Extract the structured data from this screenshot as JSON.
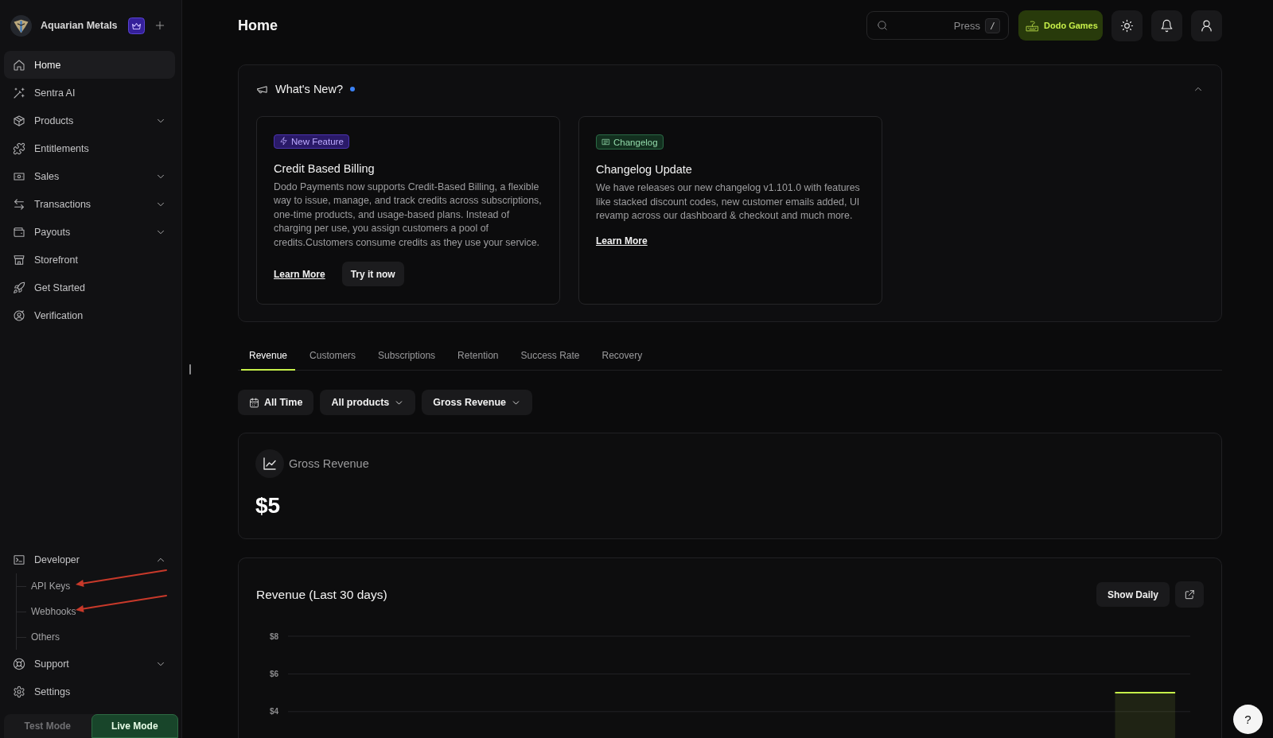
{
  "sidebar": {
    "workspace": {
      "name": "Aquarian Metals"
    },
    "items": [
      {
        "label": "Home",
        "selected": true
      },
      {
        "label": "Sentra AI",
        "selected": false
      },
      {
        "label": "Products",
        "selected": false,
        "expanded": false
      },
      {
        "label": "Entitlements",
        "selected": false
      },
      {
        "label": "Sales",
        "selected": false,
        "expanded": false
      },
      {
        "label": "Transactions",
        "selected": false,
        "expanded": false
      },
      {
        "label": "Payouts",
        "selected": false,
        "expanded": false
      },
      {
        "label": "Storefront",
        "selected": false
      },
      {
        "label": "Get Started",
        "selected": false
      },
      {
        "label": "Verification",
        "selected": false
      }
    ],
    "bottom_items": [
      {
        "label": "Developer",
        "selected": false,
        "expanded": true,
        "children": [
          {
            "label": "API Keys",
            "selected": false,
            "pointed_by_arrow": true
          },
          {
            "label": "Webhooks",
            "selected": false,
            "pointed_by_arrow": true
          },
          {
            "label": "Others",
            "selected": false,
            "pointed_by_arrow": false
          }
        ]
      },
      {
        "label": "Support",
        "selected": false,
        "expanded": false
      },
      {
        "label": "Settings",
        "selected": false
      }
    ],
    "mode_toggle": [
      {
        "label": "Test Mode",
        "selected": false
      },
      {
        "label": "Live Mode",
        "selected": true
      }
    ]
  },
  "header": {
    "title": "Home",
    "search": {
      "hint": "Press",
      "shortcut": "/"
    },
    "account_button": "Dodo Games"
  },
  "whats_new": {
    "title": "What's New?",
    "unread": true,
    "expanded": true,
    "cards": [
      {
        "badge": {
          "kind": "feature",
          "label": "New Feature"
        },
        "title": "Credit Based Billing",
        "text": "Dodo Payments now supports Credit-Based Billing, a flexible way to issue, manage, and track credits across subscriptions, one-time products, and usage-based plans. Instead of charging per use, you assign customers a pool of credits.Customers consume credits as they use your service.",
        "actions": [
          {
            "kind": "link",
            "label": "Learn More"
          },
          {
            "kind": "button",
            "label": "Try it now"
          }
        ]
      },
      {
        "badge": {
          "kind": "changelog",
          "label": "Changelog"
        },
        "title": "Changelog Update",
        "text": "We have releases our new changelog v1.101.0 with features like stacked discount codes, new customer emails added, UI revamp across our dashboard & checkout and much more.",
        "actions": [
          {
            "kind": "link",
            "label": "Learn More"
          }
        ]
      }
    ]
  },
  "tabs": [
    {
      "label": "Revenue",
      "selected": true
    },
    {
      "label": "Customers",
      "selected": false
    },
    {
      "label": "Subscriptions",
      "selected": false
    },
    {
      "label": "Retention",
      "selected": false
    },
    {
      "label": "Success Rate",
      "selected": false
    },
    {
      "label": "Recovery",
      "selected": false
    }
  ],
  "filters": [
    {
      "kind": "date",
      "label": "All Time"
    },
    {
      "kind": "dropdown",
      "label": "All products"
    },
    {
      "kind": "dropdown",
      "label": "Gross Revenue"
    }
  ],
  "metric": {
    "label": "Gross Revenue",
    "value": "$5"
  },
  "revenue_chart": {
    "toggle_button": "Show Daily",
    "chart_data": {
      "type": "area",
      "title": "Revenue (Last 30 days)",
      "ylim": [
        4,
        8
      ],
      "yticks": [
        {
          "value": 8,
          "label": "$8"
        },
        {
          "value": 6,
          "label": "$6"
        },
        {
          "value": 4,
          "label": "$4"
        }
      ],
      "series": [
        {
          "color": "#c6f04a",
          "values": [
            null,
            null,
            null,
            null,
            null,
            null,
            null,
            null,
            null,
            null,
            null,
            null,
            null,
            null,
            null,
            null,
            null,
            null,
            null,
            null,
            null,
            null,
            null,
            null,
            null,
            null,
            null,
            5,
            5,
            5
          ]
        }
      ]
    }
  },
  "help_button": "?"
}
